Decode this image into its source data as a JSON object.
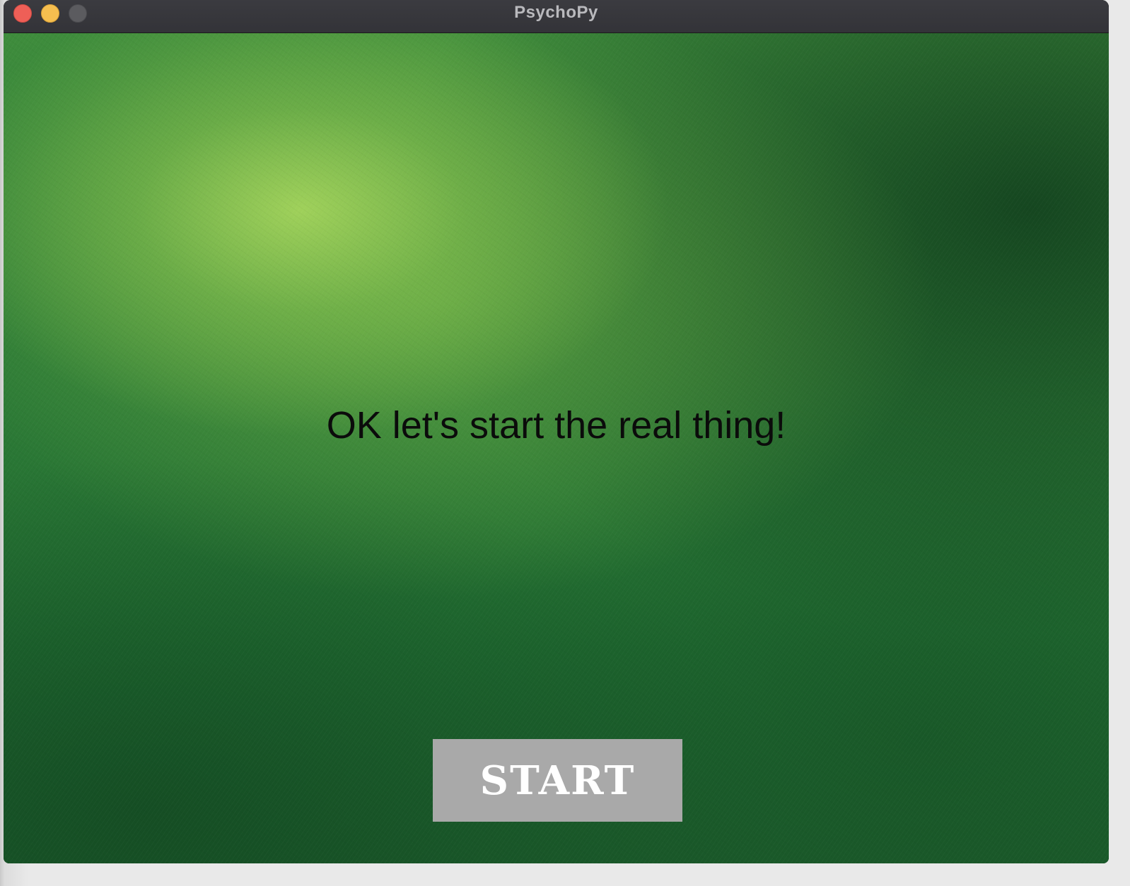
{
  "window": {
    "title": "PsychoPy"
  },
  "stage": {
    "message": "OK let's start the real thing!",
    "start_button_label": "START"
  },
  "colors": {
    "background_green": "#2c7a36",
    "highlight_green": "#a4d45c",
    "button_gray": "#a9a9a9",
    "button_text": "#ffffff",
    "message_text": "#0b0b0b"
  }
}
